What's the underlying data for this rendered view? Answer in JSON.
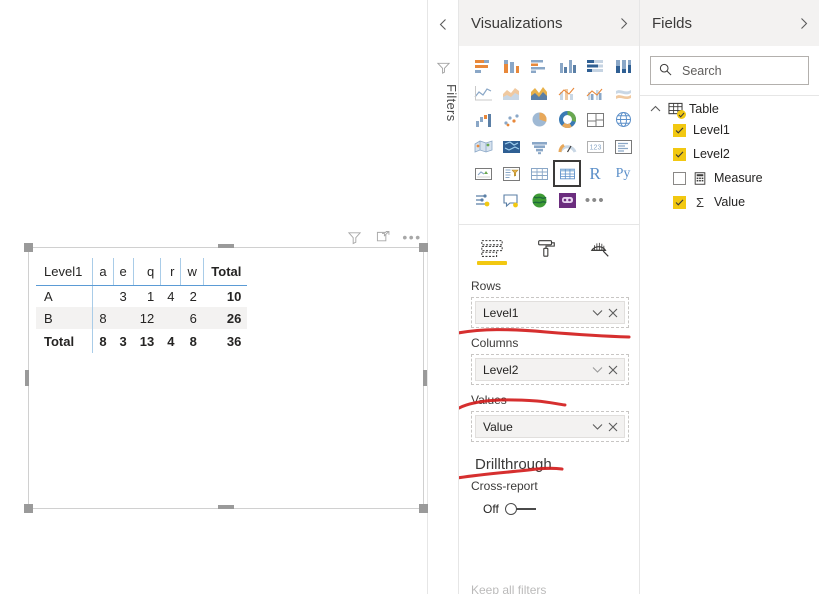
{
  "canvas": {
    "visual": {
      "header_icons": [
        "filter-icon",
        "focus-mode-icon",
        "more-options-icon"
      ],
      "matrix": {
        "row_header_label": "Level1",
        "column_headers": [
          "a",
          "e",
          "q",
          "r",
          "w"
        ],
        "total_header": "Total",
        "rows": [
          {
            "label": "A",
            "values": [
              "",
              "3",
              "1",
              "4",
              "2"
            ],
            "total": "10",
            "banded": false
          },
          {
            "label": "B",
            "values": [
              "8",
              "",
              "12",
              "",
              "6"
            ],
            "total": "26",
            "banded": true
          }
        ],
        "total_row": {
          "label": "Total",
          "values": [
            "8",
            "3",
            "13",
            "4",
            "8"
          ],
          "total": "36"
        }
      }
    }
  },
  "filters_rail": {
    "collapse_chevron": "chevron-left",
    "icon": "filter-icon",
    "label": "Filters"
  },
  "visualizations": {
    "title": "Visualizations",
    "expand_chevron": "chevron-right",
    "gallery": [
      {
        "name": "stacked-bar-chart",
        "selected": false
      },
      {
        "name": "stacked-column-chart",
        "selected": false
      },
      {
        "name": "clustered-bar-chart",
        "selected": false
      },
      {
        "name": "clustered-column-chart",
        "selected": false
      },
      {
        "name": "100-percent-stacked-bar-chart",
        "selected": false
      },
      {
        "name": "100-percent-stacked-column-chart",
        "selected": false
      },
      {
        "name": "line-chart",
        "selected": false
      },
      {
        "name": "area-chart",
        "selected": false
      },
      {
        "name": "stacked-area-chart",
        "selected": false
      },
      {
        "name": "line-stacked-column-chart",
        "selected": false
      },
      {
        "name": "line-clustered-column-chart",
        "selected": false
      },
      {
        "name": "ribbon-chart",
        "selected": false
      },
      {
        "name": "waterfall-chart",
        "selected": false
      },
      {
        "name": "scatter-chart",
        "selected": false
      },
      {
        "name": "pie-chart",
        "selected": false
      },
      {
        "name": "donut-chart",
        "selected": false
      },
      {
        "name": "treemap",
        "selected": false
      },
      {
        "name": "map",
        "selected": false
      },
      {
        "name": "filled-map",
        "selected": false
      },
      {
        "name": "shape-map",
        "selected": false
      },
      {
        "name": "funnel-chart",
        "selected": false
      },
      {
        "name": "gauge-chart",
        "selected": false
      },
      {
        "name": "card",
        "selected": false
      },
      {
        "name": "multi-row-card",
        "selected": false
      },
      {
        "name": "kpi",
        "selected": false
      },
      {
        "name": "slicer",
        "selected": false
      },
      {
        "name": "table",
        "selected": false
      },
      {
        "name": "matrix",
        "selected": true
      },
      {
        "name": "r-script-visual",
        "selected": false
      },
      {
        "name": "python-visual",
        "selected": false
      },
      {
        "name": "key-influencers",
        "selected": false
      },
      {
        "name": "qna",
        "selected": false
      },
      {
        "name": "arcgis-map",
        "selected": false
      },
      {
        "name": "custom-visual",
        "selected": false
      },
      {
        "name": "more-visuals",
        "selected": false
      }
    ],
    "tabs": [
      {
        "name": "fields-tab",
        "icon": "fields-icon",
        "active": true
      },
      {
        "name": "format-tab",
        "icon": "paint-roller-icon",
        "active": false
      },
      {
        "name": "analytics-tab",
        "icon": "magnifier-icon",
        "active": false
      }
    ],
    "wells": [
      {
        "label": "Rows",
        "chip": "Level1",
        "annotated": true
      },
      {
        "label": "Columns",
        "chip": "Level2",
        "annotated": true
      },
      {
        "label": "Values",
        "chip": "Value",
        "annotated": true
      }
    ],
    "drillthrough": {
      "title": "Drillthrough",
      "cross_report_label": "Cross-report",
      "toggle_state": "Off",
      "cut_off_label": "Keep all filters"
    }
  },
  "fields": {
    "title": "Fields",
    "expand_chevron": "chevron-right",
    "search_placeholder": "Search",
    "search_value": "",
    "table": {
      "name": "Table",
      "expanded": true,
      "items": [
        {
          "label": "Level1",
          "checked": true,
          "glyph": ""
        },
        {
          "label": "Level2",
          "checked": true,
          "glyph": ""
        },
        {
          "label": "Measure",
          "checked": false,
          "glyph": "calculator-icon"
        },
        {
          "label": "Value",
          "checked": true,
          "glyph": "sigma-icon"
        }
      ]
    }
  },
  "colors": {
    "accent_yellow": "#f2c811",
    "annotation_red": "#d21d1d",
    "matrix_rule": "#5b9bd5",
    "band": "#f3f2f1"
  }
}
